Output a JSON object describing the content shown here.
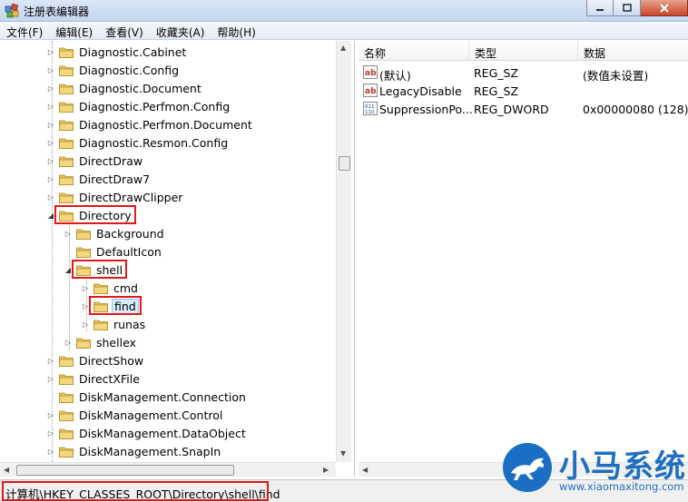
{
  "window": {
    "title": "注册表编辑器"
  },
  "menu": [
    "文件(F)",
    "编辑(E)",
    "查看(V)",
    "收藏夹(A)",
    "帮助(H)"
  ],
  "tree": [
    {
      "label": "Diagnostic.Cabinet",
      "level": 0,
      "expander": "collapsed"
    },
    {
      "label": "Diagnostic.Config",
      "level": 0,
      "expander": "collapsed"
    },
    {
      "label": "Diagnostic.Document",
      "level": 0,
      "expander": "collapsed"
    },
    {
      "label": "Diagnostic.Perfmon.Config",
      "level": 0,
      "expander": "collapsed"
    },
    {
      "label": "Diagnostic.Perfmon.Document",
      "level": 0,
      "expander": "collapsed"
    },
    {
      "label": "Diagnostic.Resmon.Config",
      "level": 0,
      "expander": "collapsed"
    },
    {
      "label": "DirectDraw",
      "level": 0,
      "expander": "collapsed"
    },
    {
      "label": "DirectDraw7",
      "level": 0,
      "expander": "collapsed"
    },
    {
      "label": "DirectDrawClipper",
      "level": 0,
      "expander": "collapsed"
    },
    {
      "label": "Directory",
      "level": 0,
      "expander": "expanded",
      "highlight": true
    },
    {
      "label": "Background",
      "level": 1,
      "expander": "collapsed"
    },
    {
      "label": "DefaultIcon",
      "level": 1,
      "expander": "none"
    },
    {
      "label": "shell",
      "level": 1,
      "expander": "expanded",
      "highlight": true
    },
    {
      "label": "cmd",
      "level": 2,
      "expander": "collapsed"
    },
    {
      "label": "find",
      "level": 2,
      "expander": "collapsed",
      "highlight": true,
      "selected": true
    },
    {
      "label": "runas",
      "level": 2,
      "expander": "collapsed"
    },
    {
      "label": "shellex",
      "level": 1,
      "expander": "collapsed"
    },
    {
      "label": "DirectShow",
      "level": 0,
      "expander": "collapsed"
    },
    {
      "label": "DirectXFile",
      "level": 0,
      "expander": "collapsed"
    },
    {
      "label": "DiskManagement.Connection",
      "level": 0,
      "expander": "none"
    },
    {
      "label": "DiskManagement.Control",
      "level": 0,
      "expander": "collapsed"
    },
    {
      "label": "DiskManagement.DataObject",
      "level": 0,
      "expander": "collapsed"
    },
    {
      "label": "DiskManagement.SnapIn",
      "level": 0,
      "expander": "collapsed"
    }
  ],
  "list": {
    "columns": [
      "名称",
      "类型",
      "数据"
    ],
    "rows": [
      {
        "icon": "string-value-icon",
        "name": "(默认)",
        "type": "REG_SZ",
        "data": "(数值未设置)"
      },
      {
        "icon": "string-value-icon",
        "name": "LegacyDisable",
        "type": "REG_SZ",
        "data": ""
      },
      {
        "icon": "dword-value-icon",
        "name": "SuppressionPo...",
        "type": "REG_DWORD",
        "data": "0x00000080 (128)"
      }
    ]
  },
  "status": {
    "path": "计算机\\HKEY_CLASSES_ROOT\\Directory\\shell\\find"
  },
  "watermark": {
    "cn": "小马系统",
    "en": "www.xiaomaxitong.com"
  },
  "colors": {
    "highlight_box": "#e01818",
    "folder": "#e8c25a",
    "brand_blue": "#1a6fc4"
  }
}
